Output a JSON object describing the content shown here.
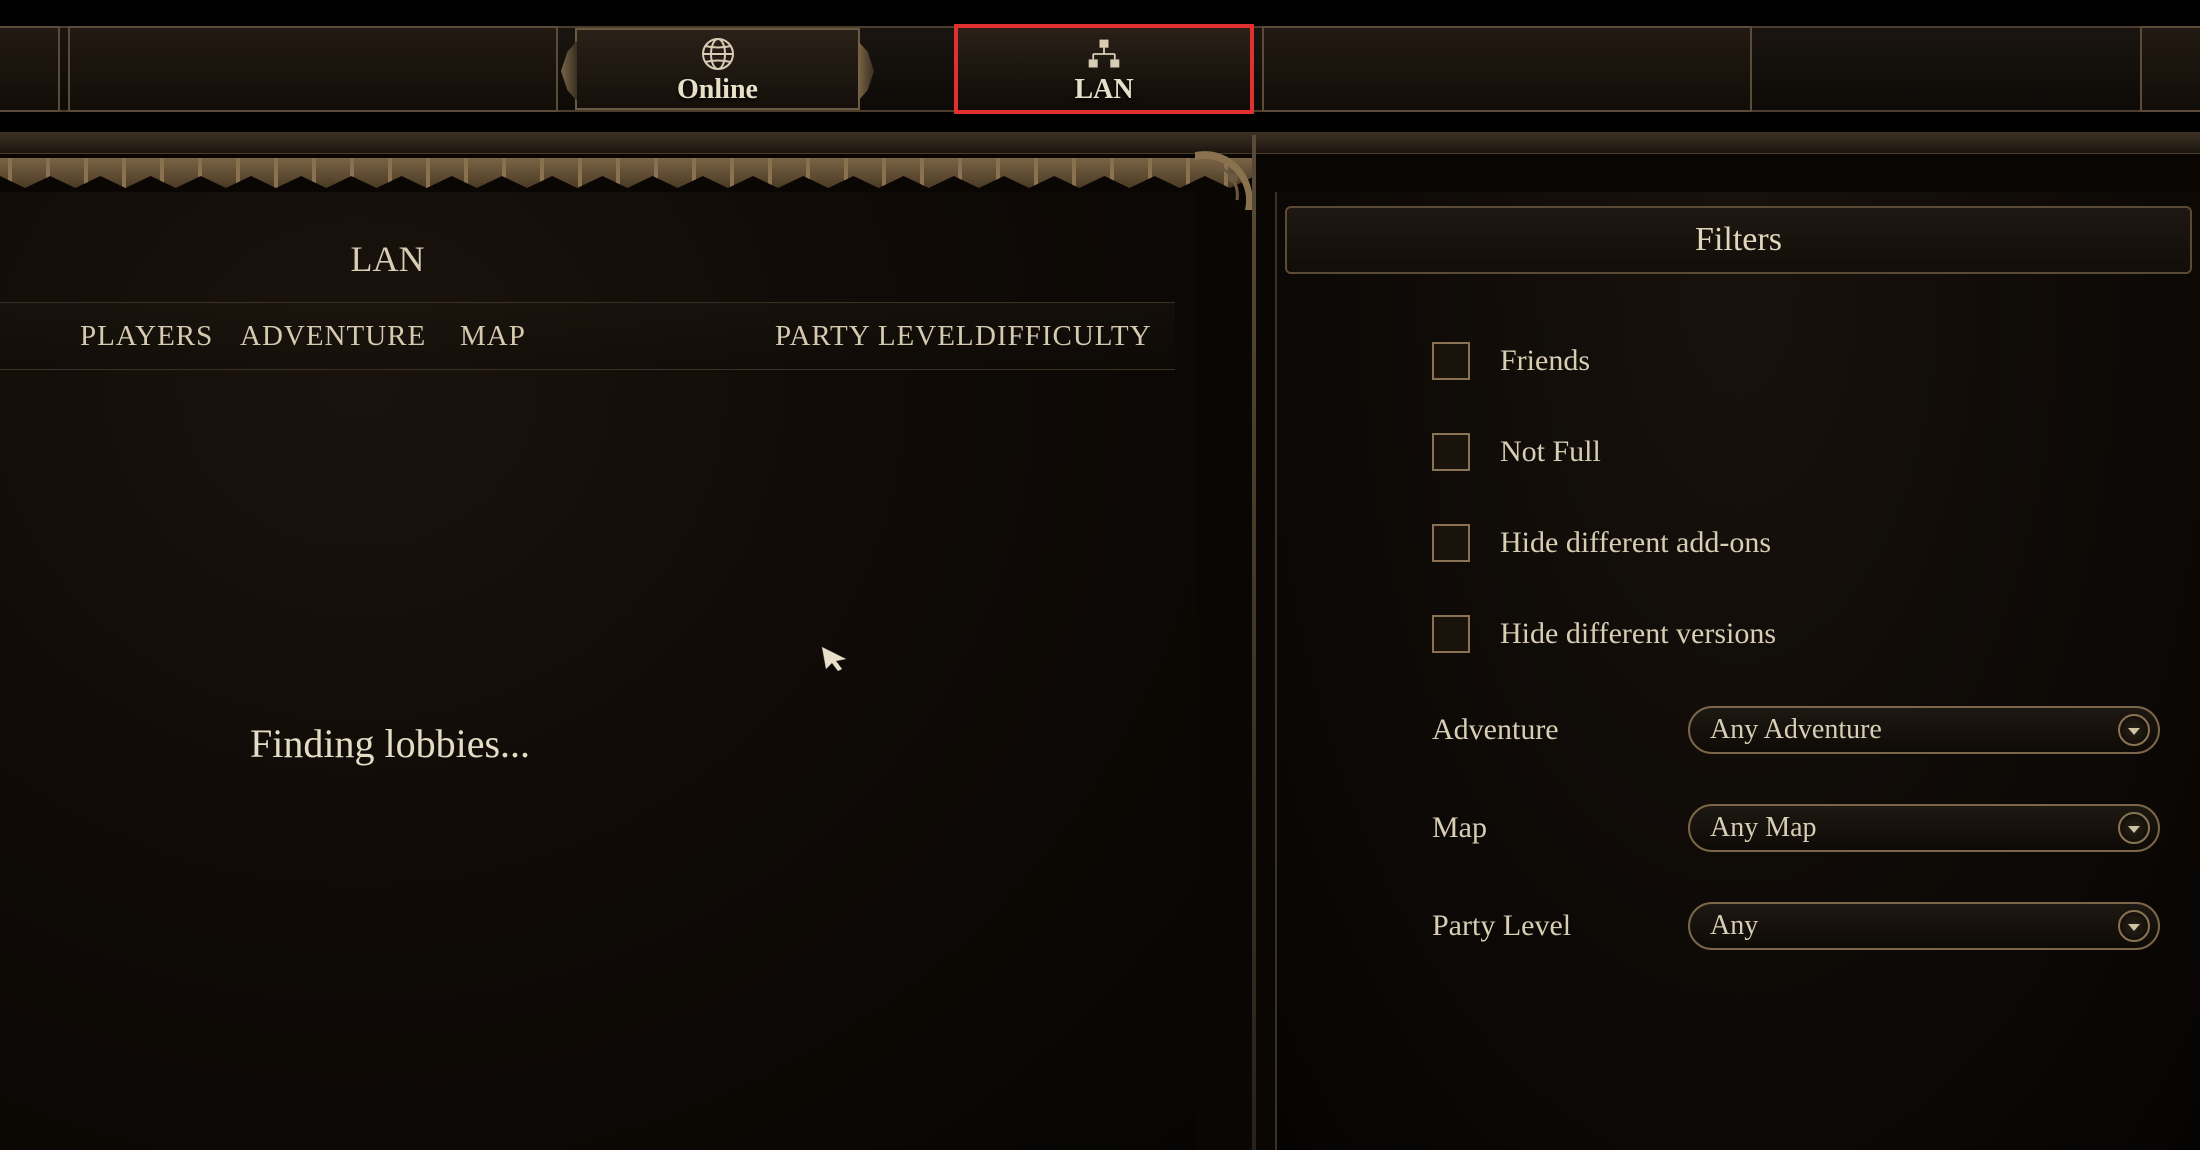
{
  "tabs": {
    "online": {
      "label": "Online"
    },
    "lan": {
      "label": "LAN"
    }
  },
  "left_panel": {
    "title": "LAN",
    "columns": {
      "players": "PLAYERS",
      "adventure": "ADVENTURE",
      "map": "MAP",
      "party_level": "PARTY LEVEL",
      "difficulty": "DIFFICULTY"
    },
    "status_text": "Finding lobbies..."
  },
  "filters": {
    "header": "Filters",
    "checkboxes": {
      "friends": "Friends",
      "not_full": "Not Full",
      "hide_addons": "Hide different add-ons",
      "hide_versions": "Hide different versions"
    },
    "dropdowns": {
      "adventure": {
        "label": "Adventure",
        "value": "Any Adventure"
      },
      "map": {
        "label": "Map",
        "value": "Any Map"
      },
      "party_level": {
        "label": "Party Level",
        "value": "Any"
      }
    }
  },
  "colors": {
    "accent_gold": "#8a7252",
    "highlight_red": "#e03030",
    "text": "#d8cdb4"
  }
}
